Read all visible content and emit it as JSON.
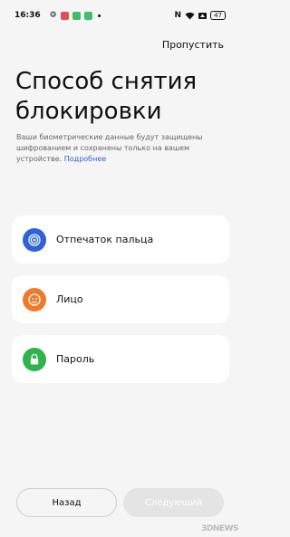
{
  "status_bar": {
    "time": "16:36",
    "battery": "47",
    "icons": [
      "gear-icon",
      "app-notification-icon",
      "wifi-icon",
      "nfc-icon",
      "signal-icon",
      "battery-icon"
    ]
  },
  "header": {
    "skip_label": "Пропустить"
  },
  "main": {
    "title": "Способ снятия блокировки",
    "description": "Ваши биометрические данные будут защищены шифрованием и сохранены только на вашем устройстве.",
    "more_link": "Подробнее"
  },
  "options": [
    {
      "label": "Отпечаток пальца",
      "icon": "fingerprint-icon",
      "color": "#2f62d8"
    },
    {
      "label": "Лицо",
      "icon": "face-icon",
      "color": "#f07a2a"
    },
    {
      "label": "Пароль",
      "icon": "lock-icon",
      "color": "#2fb34f"
    }
  ],
  "footer": {
    "back_label": "Назад",
    "next_label": "Следующий"
  },
  "watermark": "3DNEWS"
}
